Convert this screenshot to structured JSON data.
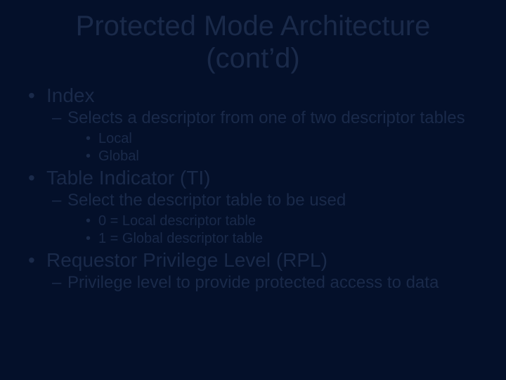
{
  "title": "Protected Mode Architecture (cont’d)",
  "bullets": [
    {
      "label": "Index",
      "sub": [
        {
          "label": "Selects a descriptor from one of two descriptor tables",
          "sub": [
            {
              "label": "Local"
            },
            {
              "label": "Global"
            }
          ]
        }
      ]
    },
    {
      "label": "Table Indicator (TI)",
      "sub": [
        {
          "label": "Select the descriptor table to be used",
          "sub": [
            {
              "label": "0 = Local descriptor table"
            },
            {
              "label": "1 = Global descriptor table"
            }
          ]
        }
      ]
    },
    {
      "label": "Requestor Privilege Level (RPL)",
      "sub": [
        {
          "label": "Privilege level to provide protected access to data",
          "sub": []
        }
      ]
    }
  ]
}
